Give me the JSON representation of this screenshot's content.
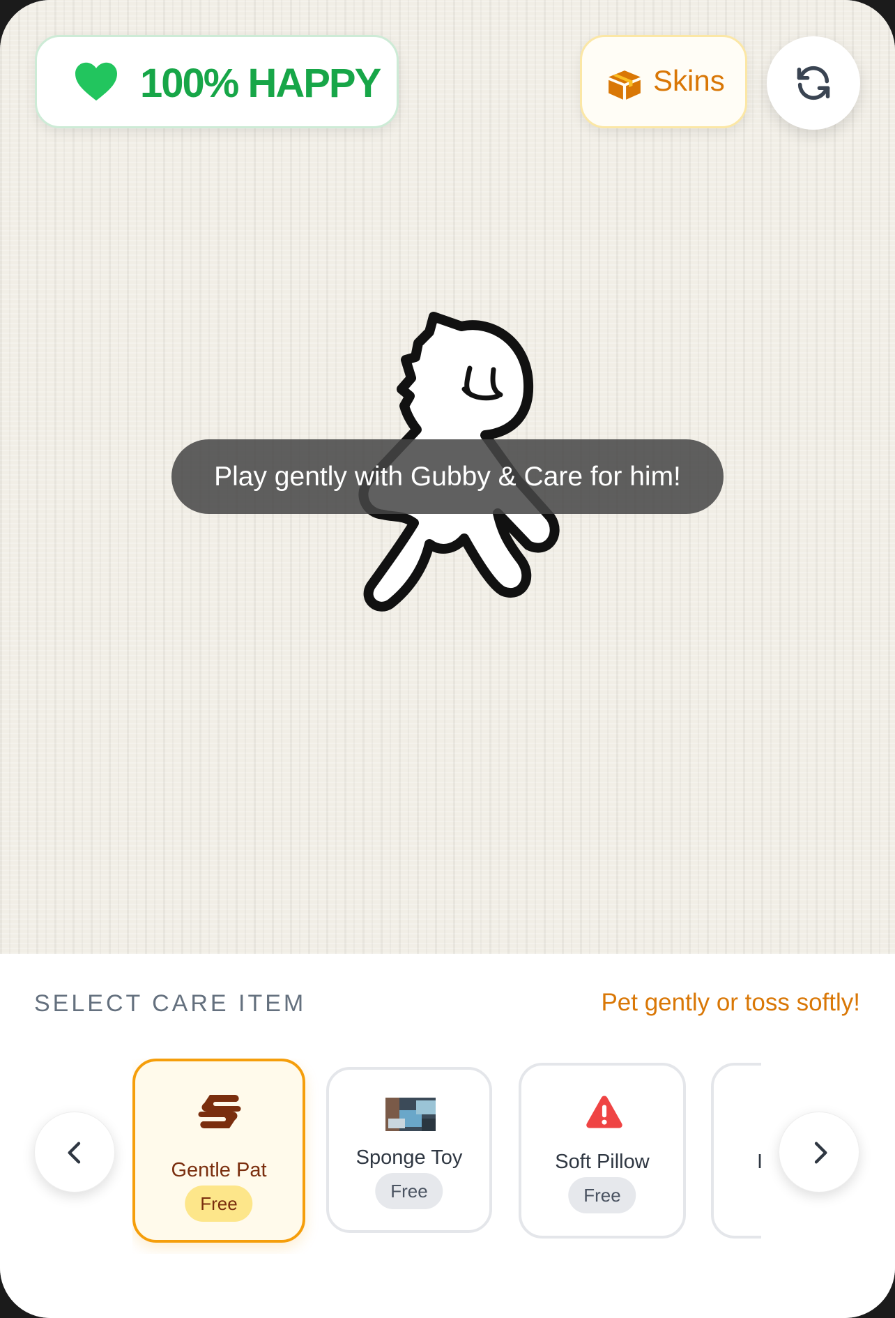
{
  "status": {
    "happiness_text": "100% HAPPY",
    "happiness_percent": 100,
    "color": "#17a648"
  },
  "header": {
    "skins_label": "Skins",
    "accent": "#d97706"
  },
  "scene": {
    "hint": "Play gently with Gubby & Care for him!"
  },
  "care_panel": {
    "title": "SELECT CARE ITEM",
    "hint": "Pet gently or toss softly!",
    "items": [
      {
        "label": "Gentle Pat",
        "price": "Free",
        "icon": "hand-icon",
        "selected": true
      },
      {
        "label": "Sponge Toy",
        "price": "Free",
        "icon": "sponge-thumbnail",
        "selected": false
      },
      {
        "label": "Soft Pillow",
        "price": "Free",
        "icon": "warning-icon",
        "selected": false
      },
      {
        "label": "I",
        "price": "",
        "icon": "",
        "selected": false
      }
    ]
  }
}
